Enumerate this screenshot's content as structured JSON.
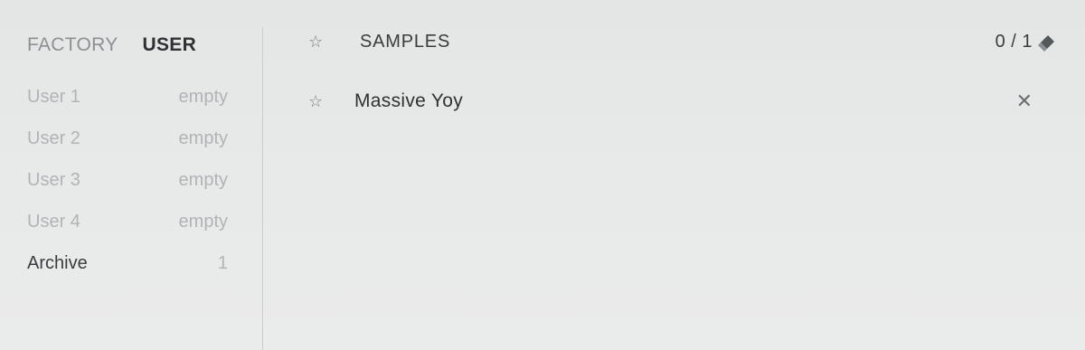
{
  "sidebar": {
    "tabs": {
      "factory": "FACTORY",
      "user": "USER"
    },
    "slots": [
      {
        "name": "User 1",
        "value": "empty"
      },
      {
        "name": "User 2",
        "value": "empty"
      },
      {
        "name": "User 3",
        "value": "empty"
      },
      {
        "name": "User 4",
        "value": "empty"
      },
      {
        "name": "Archive",
        "value": "1"
      }
    ]
  },
  "main": {
    "header": {
      "star_icon": "star-outline",
      "label": "SAMPLES",
      "counter": "0 / 1",
      "eraser_icon": "eraser"
    },
    "items": [
      {
        "star_icon": "star-outline",
        "label": "Massive Yoy",
        "close_icon": "close"
      }
    ]
  },
  "colors": {
    "background": "#e6e8e8",
    "text_primary": "#2f3133",
    "text_muted": "#b1b4b6",
    "divider": "#c9cbcc"
  }
}
